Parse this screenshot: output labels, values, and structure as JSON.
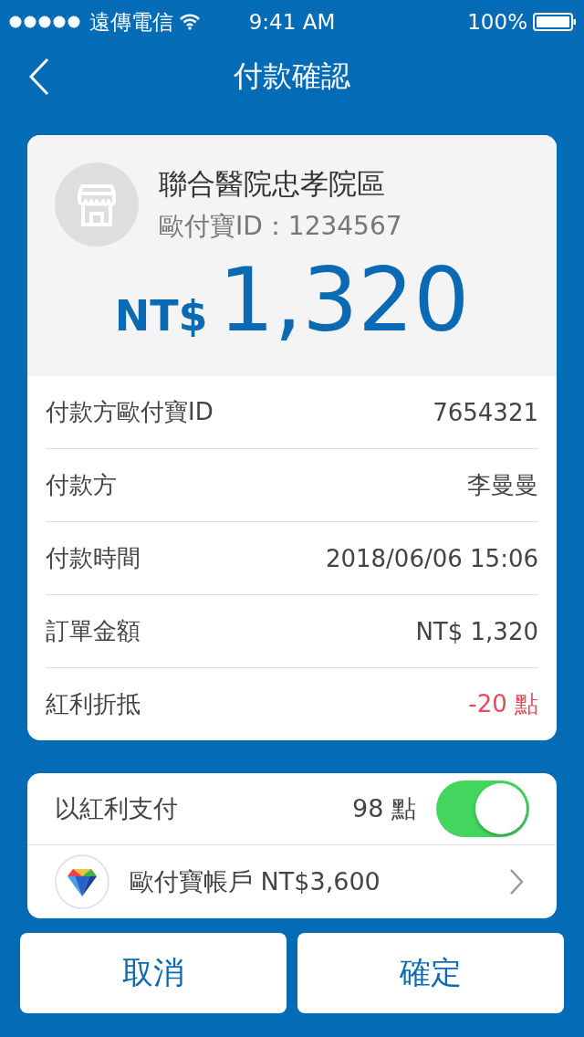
{
  "status_bar": {
    "carrier": "遠傳電信",
    "time": "9:41 AM",
    "battery": "100%"
  },
  "nav": {
    "title": "付款確認"
  },
  "merchant": {
    "name": "聯合醫院忠孝院區",
    "id": "歐付寶ID：1234567",
    "currency": "NT$",
    "amount": "1,320"
  },
  "details": [
    {
      "label": "付款方歐付寶ID",
      "value": "7654321",
      "kind": "plain"
    },
    {
      "label": "付款方",
      "value": "李曼曼",
      "kind": "plain"
    },
    {
      "label": "付款時間",
      "value": "2018/06/06 15:06",
      "kind": "plain"
    },
    {
      "label": "訂單金額",
      "value": "NT$ 1,320",
      "kind": "plain"
    },
    {
      "label": "紅利折抵",
      "value": "-20 點",
      "kind": "deduction"
    }
  ],
  "bonus": {
    "label": "以紅利支付",
    "points": "98 點",
    "on": true
  },
  "account": {
    "label": "歐付寶帳戶 NT$3,600"
  },
  "buttons": [
    "取消",
    "確定"
  ]
}
